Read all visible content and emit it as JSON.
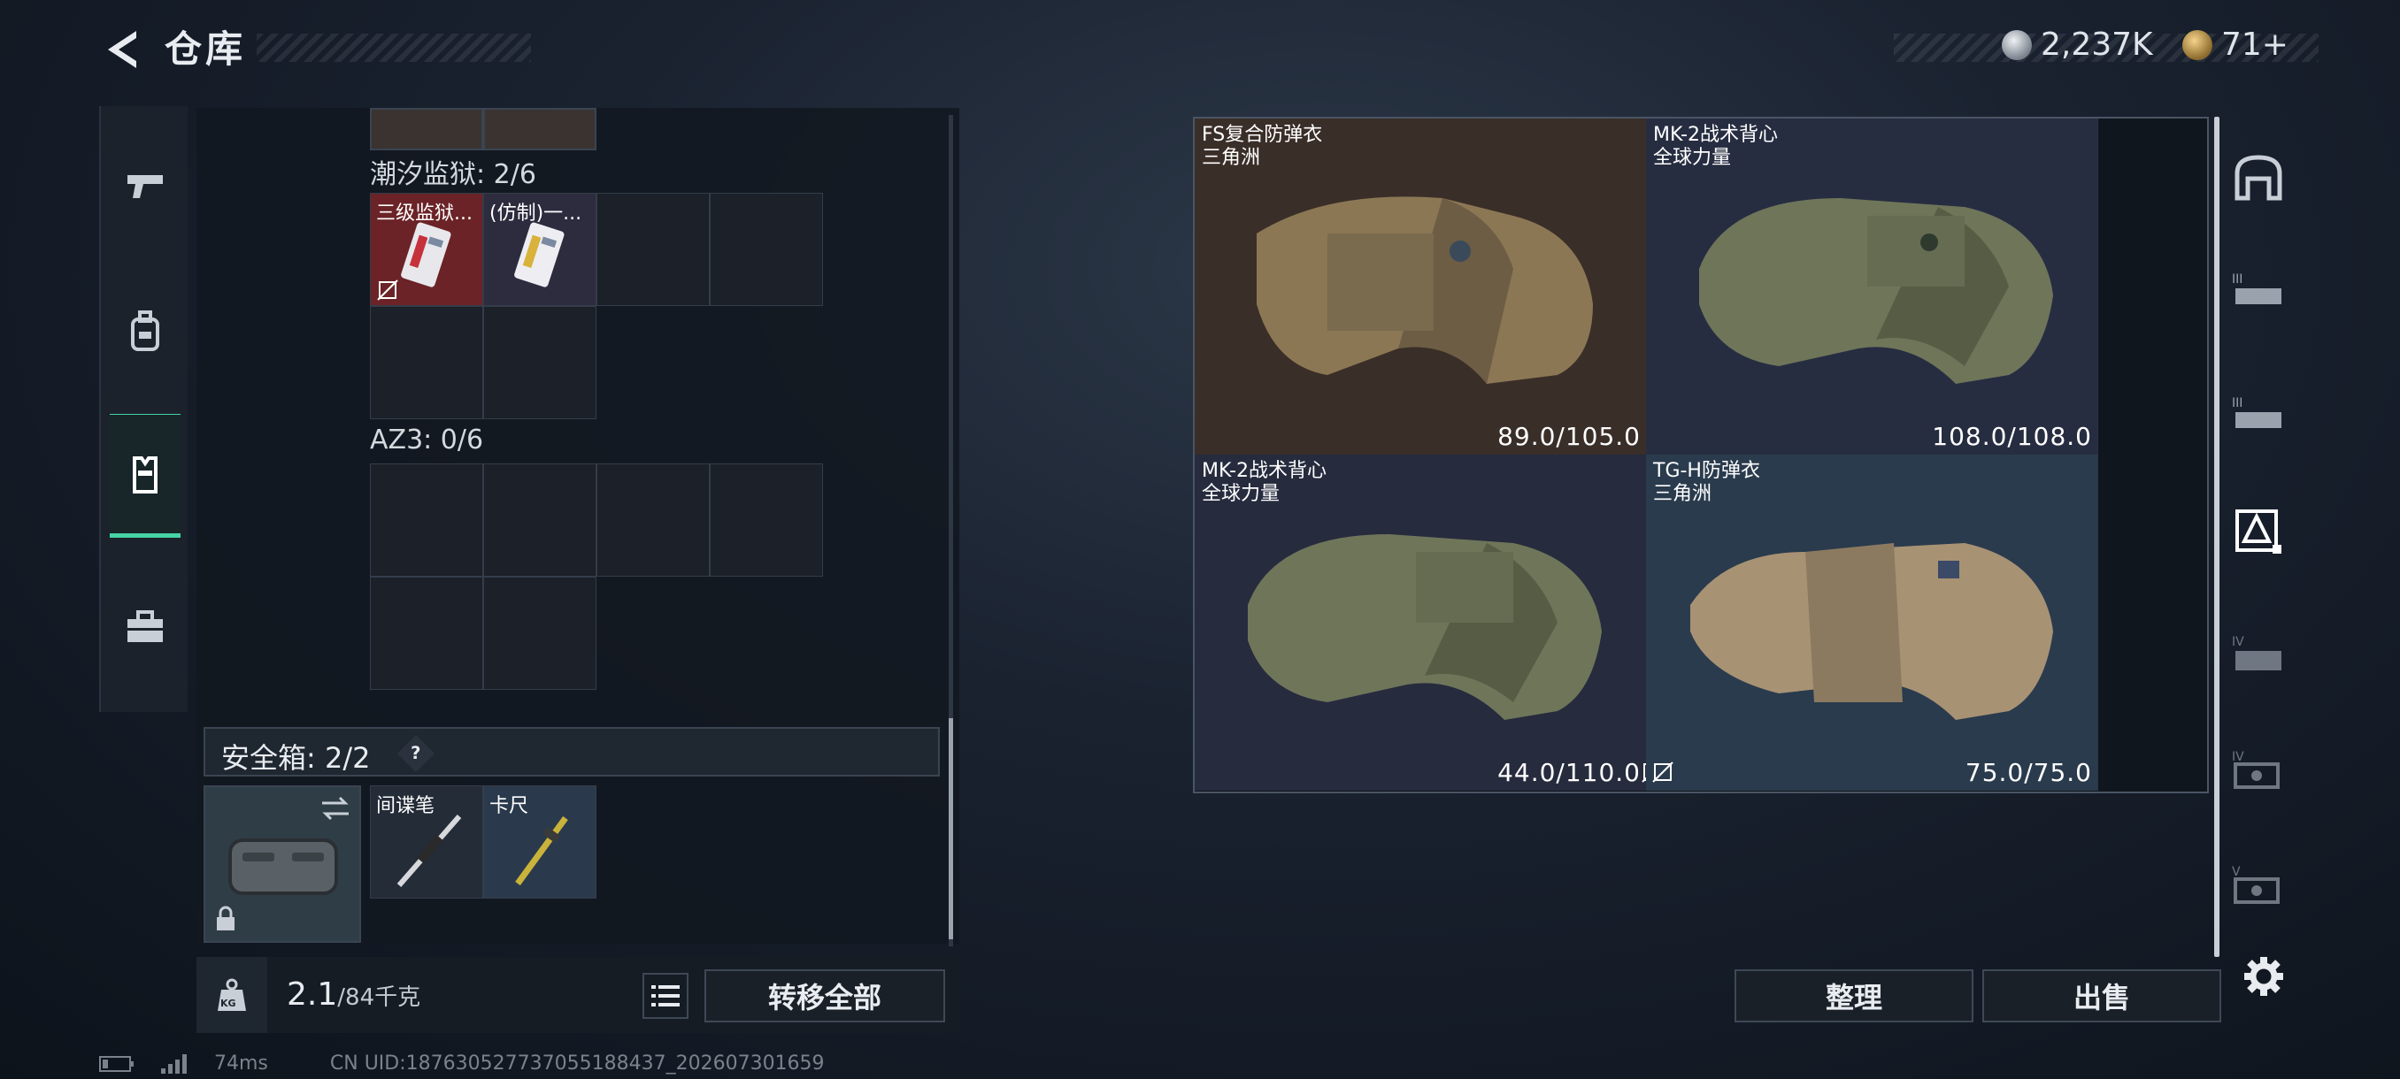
{
  "header": {
    "title": "仓库",
    "currency1": "2,237K",
    "currency2": "71+"
  },
  "left_panel": {
    "section1_label": "潮汐监狱: 2/6",
    "section1_items": [
      {
        "name": "三级监狱...",
        "color": "#6b2327"
      },
      {
        "name": "(仿制)一...",
        "color": "#2d2b3e"
      }
    ],
    "section2_label": "AZ3: 0/6",
    "safe_label": "安全箱: 2/2",
    "safe_help": "?",
    "safe_items": [
      {
        "name": "间谍笔"
      },
      {
        "name": "卡尺"
      }
    ],
    "weight_current": "2.1",
    "weight_max": "/84千克",
    "transfer_all": "转移全部",
    "kg_label": "KG"
  },
  "storage": {
    "items": [
      {
        "name": "FS复合防弹衣",
        "faction": "三角洲",
        "durability": "89.0/105.0",
        "bg": "#3a2e28"
      },
      {
        "name": "MK-2战术背心",
        "faction": "全球力量",
        "durability": "108.0/108.0",
        "bg": "#272d41"
      },
      {
        "name": "MK-2战术背心",
        "faction": "全球力量",
        "durability": "44.0/110.0",
        "bg": "#262b3e"
      },
      {
        "name": "TG-H防弹衣",
        "faction": "三角洲",
        "durability": "75.0/75.0",
        "bg": "#2a3b4d"
      }
    ],
    "sort_button": "整理",
    "sell_button": "出售"
  },
  "footer": {
    "ping": "74ms",
    "uid": "CN UID:18763052773705518843​7_202607301659"
  },
  "colors": {
    "accent": "#46d3a5",
    "red_item": "#6b2327"
  }
}
